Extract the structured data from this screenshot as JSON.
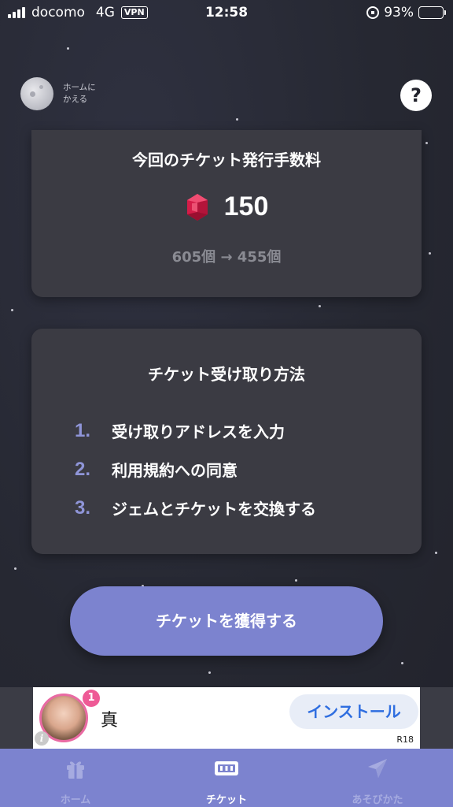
{
  "status_bar": {
    "carrier": "docomo",
    "network": "4G",
    "vpn": "VPN",
    "time": "12:58",
    "battery_percent": "93%",
    "battery_level": 0.93
  },
  "header": {
    "home_back_label": "ホームに\nかえる",
    "help_label": "?"
  },
  "fee_card": {
    "title": "今回のチケット発行手数料",
    "gem_icon": "ruby-gem-icon",
    "fee_value": "150",
    "balance_change": "605個 → 455個"
  },
  "steps_card": {
    "title": "チケット受け取り方法",
    "steps": [
      {
        "num": "1.",
        "text": "受け取りアドレスを入力"
      },
      {
        "num": "2.",
        "text": "利用規約への同意"
      },
      {
        "num": "3.",
        "text": "ジェムとチケットを交換する"
      }
    ]
  },
  "cta": {
    "label": "チケットを獲得する"
  },
  "ad": {
    "badge_count": "1",
    "name": "真",
    "install_label": "インストール",
    "rating": "R18",
    "info_icon": "i"
  },
  "tab_bar": {
    "tabs": [
      {
        "label": "ホーム",
        "icon": "gift-icon"
      },
      {
        "label": "チケット",
        "icon": "ticket-icon"
      },
      {
        "label": "あそびかた",
        "icon": "paper-plane-icon"
      }
    ],
    "active_index": 1
  },
  "colors": {
    "background": "#262832",
    "card": "#3b3b43",
    "accent": "#7c83cf",
    "step_number": "#8f95d8",
    "gem": "#e0204f",
    "install_text": "#2f6ee0"
  }
}
